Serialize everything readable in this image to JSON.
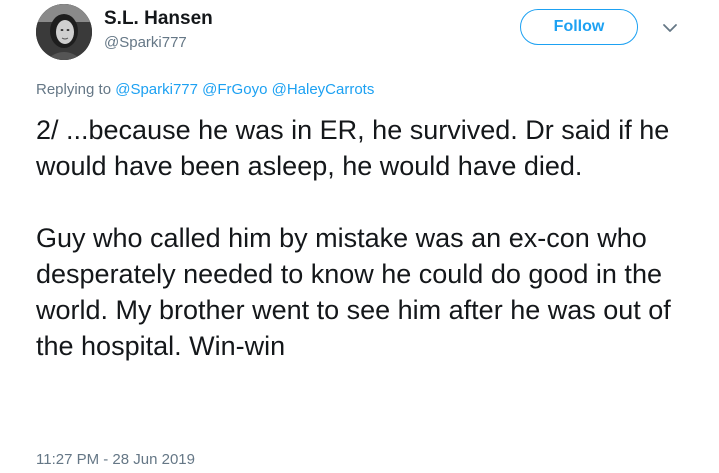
{
  "author": {
    "display_name": "S.L. Hansen",
    "handle": "@Sparki777",
    "avatar_icon": "profile-photo"
  },
  "actions": {
    "follow_label": "Follow",
    "more_icon": "chevron-down-icon"
  },
  "reply": {
    "prefix": "Replying to",
    "mentions": [
      "@Sparki777",
      "@FrGoyo",
      "@HaleyCarrots"
    ]
  },
  "tweet": {
    "paragraphs": [
      "2/ ...because he was in ER, he survived. Dr said if he would have been asleep, he would have died.",
      "Guy who called him by mistake was an ex-con who desperately needed to know he could do good in the world. My brother went to see him after he was out of the hospital. Win-win"
    ],
    "timestamp": "11:27 PM - 28 Jun 2019"
  },
  "colors": {
    "accent": "#1da1f2",
    "text": "#14171a",
    "muted": "#657786"
  }
}
